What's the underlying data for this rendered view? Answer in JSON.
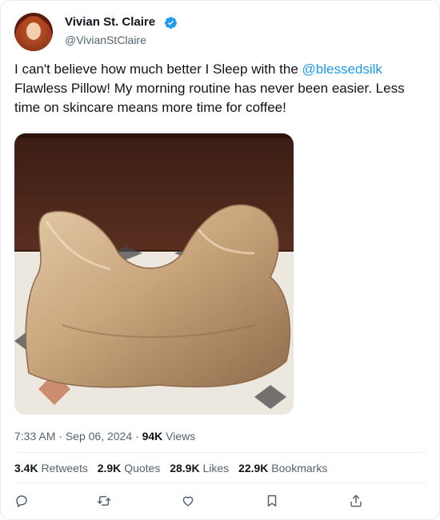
{
  "author": {
    "name": "Vivian St. Claire",
    "handle": "@VivianStClaire",
    "verified_icon": "verified-badge-icon",
    "accent": "#1d9bf0"
  },
  "tweet": {
    "text_before": "I can't believe how much better I Sleep with the ",
    "mention": "@blessedsilk",
    "text_after": " Flawless Pillow! My morning routine has never been easier. Less time on skincare means more time for coffee!"
  },
  "meta": {
    "time": "7:33 AM",
    "date": "Sep 06, 2024",
    "separator": "·",
    "views_count": "94K",
    "views_label": "Views"
  },
  "stats": {
    "retweets_count": "3.4K",
    "retweets_label": "Retweets",
    "quotes_count": "2.9K",
    "quotes_label": "Quotes",
    "likes_count": "28.9K",
    "likes_label": "Likes",
    "bookmarks_count": "22.9K",
    "bookmarks_label": "Bookmarks"
  },
  "actions": [
    "reply-icon",
    "retweet-icon",
    "like-icon",
    "bookmark-icon",
    "share-icon"
  ]
}
